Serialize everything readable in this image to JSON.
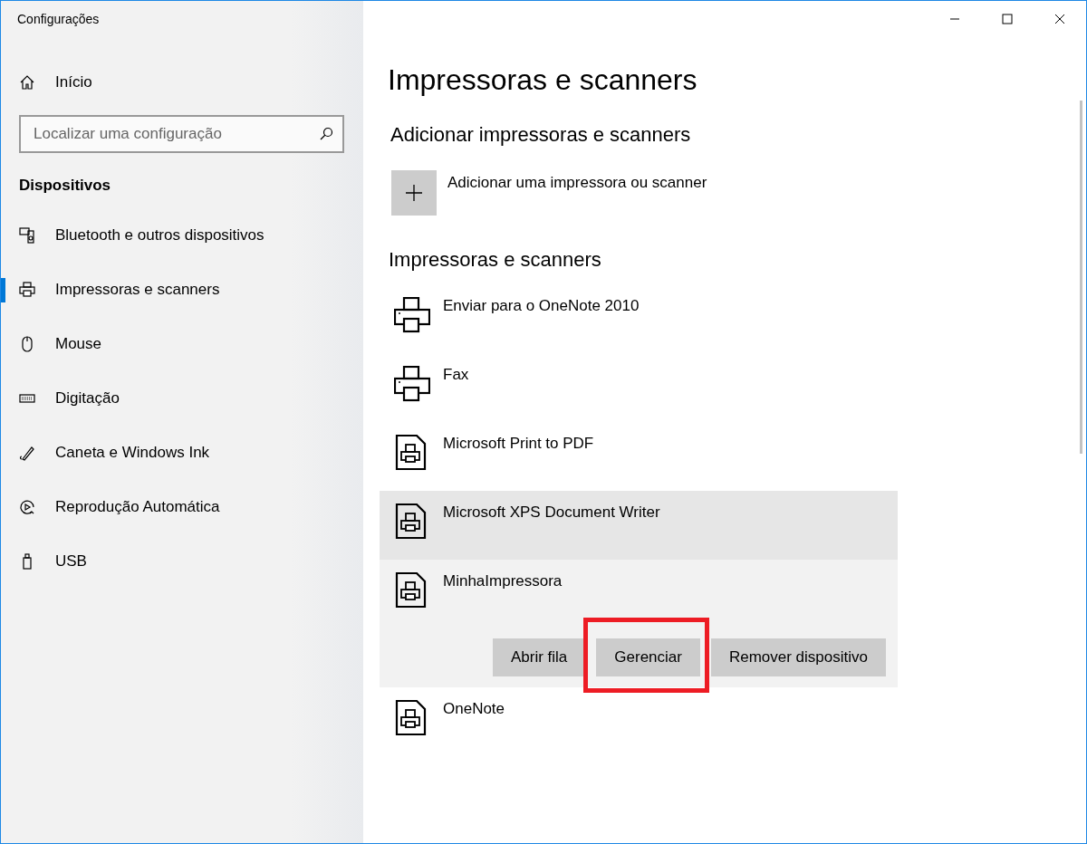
{
  "window": {
    "title": "Configurações"
  },
  "sidebar": {
    "home": {
      "label": "Início"
    },
    "search": {
      "placeholder": "Localizar uma configuração"
    },
    "section": "Dispositivos",
    "items": [
      {
        "label": "Bluetooth e outros dispositivos",
        "kind": "bluetooth",
        "selected": false
      },
      {
        "label": "Impressoras e scanners",
        "kind": "printer",
        "selected": true
      },
      {
        "label": "Mouse",
        "kind": "mouse",
        "selected": false
      },
      {
        "label": "Digitação",
        "kind": "keyboard",
        "selected": false
      },
      {
        "label": "Caneta e Windows Ink",
        "kind": "pen",
        "selected": false
      },
      {
        "label": "Reprodução Automática",
        "kind": "autoplay",
        "selected": false
      },
      {
        "label": "USB",
        "kind": "usb",
        "selected": false
      }
    ]
  },
  "main": {
    "title": "Impressoras e scanners",
    "add_section": {
      "heading": "Adicionar impressoras e scanners",
      "add_label": "Adicionar uma impressora ou scanner"
    },
    "list_heading": "Impressoras e scanners",
    "printers": [
      {
        "name": "Enviar para o OneNote 2010",
        "kind": "printer",
        "hovered": false,
        "expanded": false
      },
      {
        "name": "Fax",
        "kind": "printer",
        "hovered": false,
        "expanded": false
      },
      {
        "name": "Microsoft Print to PDF",
        "kind": "document",
        "hovered": false,
        "expanded": false
      },
      {
        "name": "Microsoft XPS Document Writer",
        "kind": "document",
        "hovered": true,
        "expanded": false
      },
      {
        "name": "MinhaImpressora",
        "kind": "document",
        "hovered": false,
        "expanded": true,
        "buttons": [
          {
            "label": "Abrir fila",
            "highlighted": false
          },
          {
            "label": "Gerenciar",
            "highlighted": true
          },
          {
            "label": "Remover dispositivo",
            "highlighted": false
          }
        ]
      },
      {
        "name": "OneNote",
        "kind": "document",
        "hovered": false,
        "expanded": false
      }
    ]
  }
}
